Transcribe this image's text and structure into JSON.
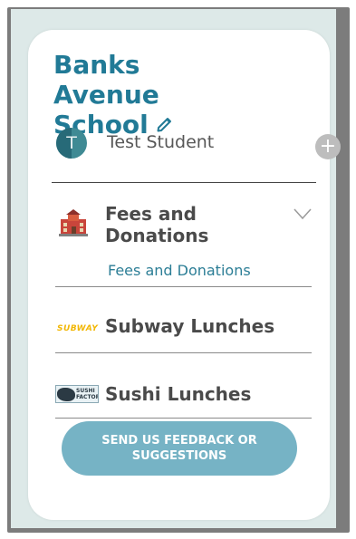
{
  "school": {
    "name": "Banks Avenue School",
    "edit_icon": "pencil-icon"
  },
  "student": {
    "initial": "T",
    "name": "Test Student",
    "add_icon": "plus-icon"
  },
  "menu": [
    {
      "label": "Fees and Donations",
      "icon": "school-building-icon",
      "expanded": true,
      "children": [
        "Fees and Donations"
      ]
    },
    {
      "label": "Subway Lunches",
      "icon": "subway-logo",
      "logo_text": "SUBWAY"
    },
    {
      "label": "Sushi Lunches",
      "icon": "sushi-factory-logo",
      "logo_text": "SUSHI FACTORY"
    }
  ],
  "feedback_button": "SEND US FEEDBACK OR SUGGESTIONS",
  "colors": {
    "accent": "#217a96",
    "button": "#76b3c5",
    "background": "#dde9e8"
  }
}
